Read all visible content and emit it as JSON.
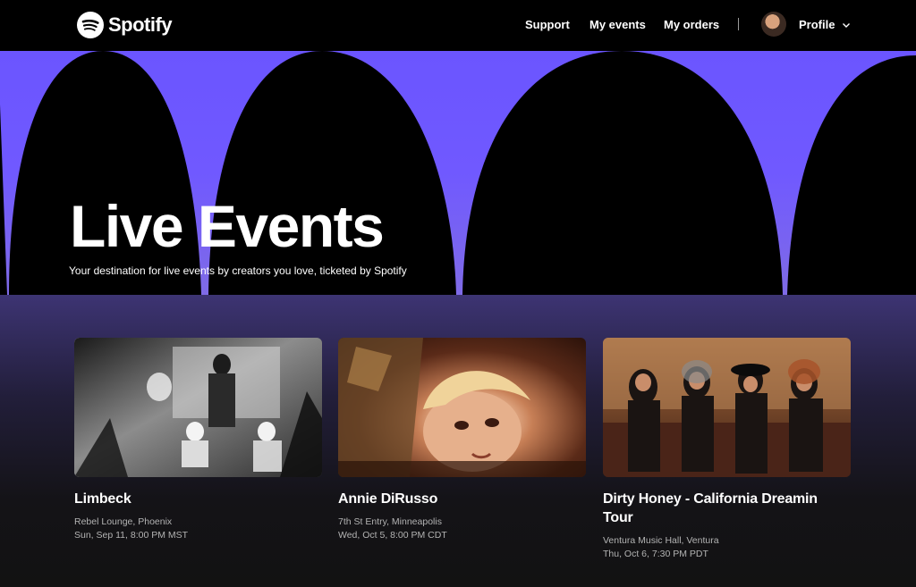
{
  "brand": {
    "name": "Spotify",
    "logo_icon": "spotify-logo-icon",
    "color": "#ffffff"
  },
  "nav": {
    "support": "Support",
    "my_events": "My events",
    "my_orders": "My orders",
    "profile": "Profile",
    "profile_icon": "chevron-down-icon"
  },
  "hero": {
    "title": "Live Events",
    "subtitle": "Your destination for live events by creators you love, ticketed by Spotify",
    "accent": "#6f58ff"
  },
  "events": [
    {
      "name": "Limbeck",
      "venue": "Rebel Lounge, Phoenix",
      "date": "Sun, Sep 11, 8:00 PM MST"
    },
    {
      "name": "Annie DiRusso",
      "venue": "7th St Entry, Minneapolis",
      "date": "Wed, Oct 5, 8:00 PM CDT"
    },
    {
      "name": "Dirty Honey - California Dreamin Tour",
      "venue": "Ventura Music Hall, Ventura",
      "date": "Thu, Oct 6, 7:30 PM PDT"
    }
  ]
}
